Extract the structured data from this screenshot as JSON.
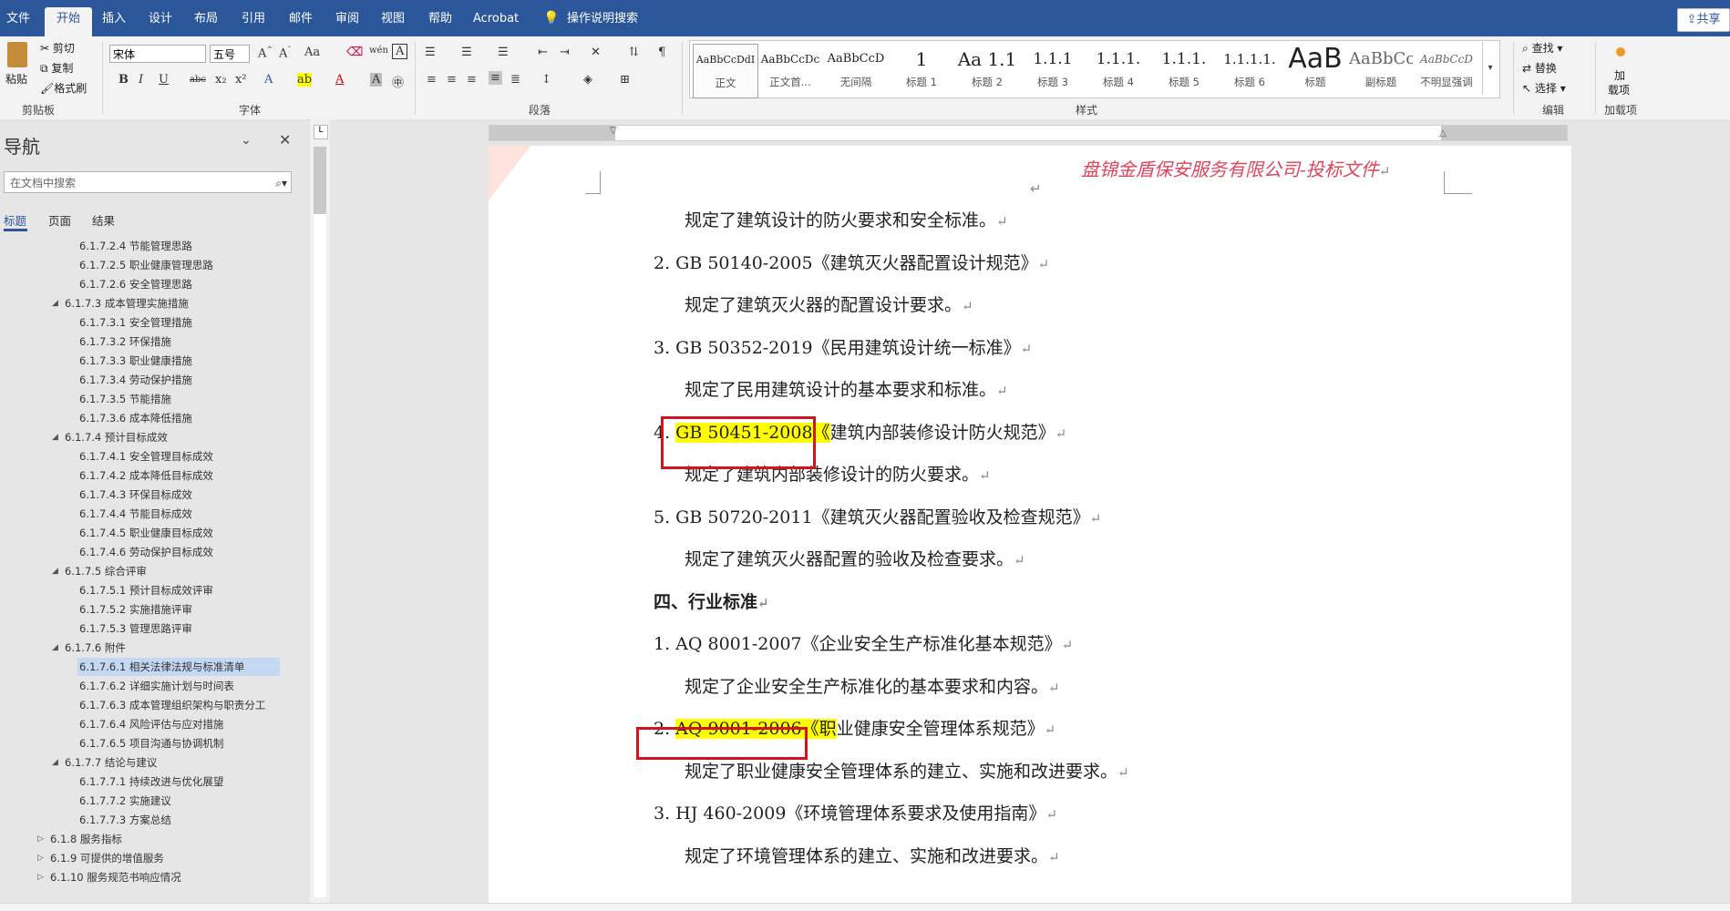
{
  "ribbon_tabs": [
    "文件",
    "开始",
    "插入",
    "设计",
    "布局",
    "引用",
    "邮件",
    "审阅",
    "视图",
    "帮助",
    "Acrobat"
  ],
  "tell_me": "操作说明搜索",
  "share_label": "共享",
  "clipboard": {
    "paste": "粘贴",
    "cut": "剪切",
    "copy": "复制",
    "format_painter": "格式刷",
    "group": "剪贴板"
  },
  "font": {
    "name": "宋体",
    "size": "五号",
    "group": "字体"
  },
  "paragraph_group": "段落",
  "styles": [
    {
      "preview": "AaBbCcDdI",
      "name": "正文"
    },
    {
      "preview": "AaBbCcDc",
      "name": "正文首..."
    },
    {
      "preview": "AaBbCcD",
      "name": "无间隔"
    },
    {
      "preview": "1",
      "name": "标题 1"
    },
    {
      "preview": "Aa 1.1",
      "name": "标题 2"
    },
    {
      "preview": "1.1.1",
      "name": "标题 3"
    },
    {
      "preview": "1.1.1.",
      "name": "标题 4"
    },
    {
      "preview": "1.1.1.",
      "name": "标题 5"
    },
    {
      "preview": "1.1.1.1.",
      "name": "标题 6"
    },
    {
      "preview": "AaB",
      "name": "标题"
    },
    {
      "preview": "AaBbCc",
      "name": "副标题"
    },
    {
      "preview": "AaBbCcD",
      "name": "不明显强调"
    }
  ],
  "styles_group": "样式",
  "editing": {
    "find": "查找",
    "replace": "替换",
    "select": "选择",
    "group": "编辑"
  },
  "addins": {
    "label1": "加",
    "label2": "载项",
    "group": "加载项"
  },
  "nav": {
    "title": "导航",
    "search_placeholder": "在文档中搜索",
    "tabs": [
      "标题",
      "页面",
      "结果"
    ],
    "items": [
      {
        "text": "6.1.7.2.4 节能管理思路",
        "level": 3
      },
      {
        "text": "6.1.7.2.5 职业健康管理思路",
        "level": 3
      },
      {
        "text": "6.1.7.2.6 安全管理思路",
        "level": 3
      },
      {
        "text": "6.1.7.3 成本管理实施措施",
        "level": 2
      },
      {
        "text": "6.1.7.3.1 安全管理措施",
        "level": 3
      },
      {
        "text": "6.1.7.3.2 环保措施",
        "level": 3
      },
      {
        "text": "6.1.7.3.3 职业健康措施",
        "level": 3
      },
      {
        "text": "6.1.7.3.4 劳动保护措施",
        "level": 3
      },
      {
        "text": "6.1.7.3.5 节能措施",
        "level": 3
      },
      {
        "text": "6.1.7.3.6 成本降低措施",
        "level": 3
      },
      {
        "text": "6.1.7.4 预计目标成效",
        "level": 2
      },
      {
        "text": "6.1.7.4.1 安全管理目标成效",
        "level": 3
      },
      {
        "text": "6.1.7.4.2 成本降低目标成效",
        "level": 3
      },
      {
        "text": "6.1.7.4.3 环保目标成效",
        "level": 3
      },
      {
        "text": "6.1.7.4.4 节能目标成效",
        "level": 3
      },
      {
        "text": "6.1.7.4.5 职业健康目标成效",
        "level": 3
      },
      {
        "text": "6.1.7.4.6 劳动保护目标成效",
        "level": 3
      },
      {
        "text": "6.1.7.5 综合评审",
        "level": 2
      },
      {
        "text": "6.1.7.5.1 预计目标成效评审",
        "level": 3
      },
      {
        "text": "6.1.7.5.2 实施措施评审",
        "level": 3
      },
      {
        "text": "6.1.7.5.3 管理思路评审",
        "level": 3
      },
      {
        "text": "6.1.7.6 附件",
        "level": 2
      },
      {
        "text": "6.1.7.6.1 相关法律法规与标准清单",
        "level": 3
      },
      {
        "text": "6.1.7.6.2 详细实施计划与时间表",
        "level": 3
      },
      {
        "text": "6.1.7.6.3 成本管理组织架构与职责分工",
        "level": 3
      },
      {
        "text": "6.1.7.6.4 风险评估与应对措施",
        "level": 3
      },
      {
        "text": "6.1.7.6.5 项目沟通与协调机制",
        "level": 3
      },
      {
        "text": "6.1.7.7 结论与建议",
        "level": 2
      },
      {
        "text": "6.1.7.7.1 持续改进与优化展望",
        "level": 3
      },
      {
        "text": "6.1.7.7.2 实施建议",
        "level": 3
      },
      {
        "text": "6.1.7.7.3 方案总结",
        "level": 3
      },
      {
        "text": "6.1.8 服务指标",
        "level": 1
      },
      {
        "text": "6.1.9 可提供的增值服务",
        "level": 1
      },
      {
        "text": "6.1.10 服务规范书响应情况",
        "level": 1
      }
    ]
  },
  "doc": {
    "header_text": "盘锦金盾保安服务有限公司-投标文件",
    "lines": [
      {
        "text": "规定了建筑设计的防火要求和安全标准。",
        "indent": 2
      },
      {
        "text": "2.  GB 50140-2005《建筑灭火器配置设计规范》",
        "indent": 1
      },
      {
        "text": "规定了建筑灭火器的配置设计要求。",
        "indent": 2
      },
      {
        "text": "3.  GB 50352-2019《民用建筑设计统一标准》",
        "indent": 1
      },
      {
        "text": "规定了民用建筑设计的基本要求和标准。",
        "indent": 2
      },
      {
        "pre": "4.  ",
        "hl": "GB 50451-2008《",
        "post": "建筑内部装修设计防火规范》",
        "indent": 1
      },
      {
        "text": "规定了建筑内部装修设计的防火要求。",
        "indent": 2
      },
      {
        "text": "5.  GB 50720-2011《建筑灭火器配置验收及检查规范》",
        "indent": 1
      },
      {
        "text": "规定了建筑灭火器配置的验收及检查要求。",
        "indent": 2
      },
      {
        "text": "四、行业标准",
        "indent": 1,
        "bold": true
      },
      {
        "text": "1.  AQ 8001-2007《企业安全生产标准化基本规范》",
        "indent": 1
      },
      {
        "text": "规定了企业安全生产标准化的基本要求和内容。",
        "indent": 2
      },
      {
        "pre": "2.  ",
        "hl": "AQ 9001-2006《职",
        "post": "业健康安全管理体系规范》",
        "indent": 1
      },
      {
        "text": "规定了职业健康安全管理体系的建立、实施和改进要求。",
        "indent": 2
      },
      {
        "text": "3.  HJ 460-2009《环境管理体系要求及使用指南》",
        "indent": 1
      },
      {
        "text": "规定了环境管理体系的建立、实施和改进要求。",
        "indent": 2
      }
    ],
    "paragraph_mark": "↵"
  },
  "colors": {
    "brand": "#2b579a",
    "highlight": "#fffe00",
    "annotation_box": "#d3141f",
    "header_text": "#e0445a"
  }
}
